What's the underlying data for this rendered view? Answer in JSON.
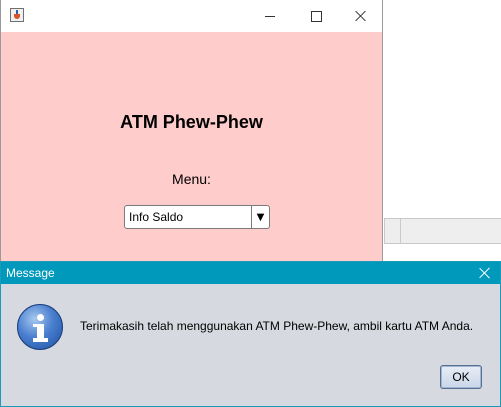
{
  "main_window": {
    "app_title": "ATM Phew-Phew",
    "menu_label": "Menu:",
    "menu_selected": "Info Saldo",
    "icons": {
      "app": "java-cup-icon",
      "minimize": "minimize-icon",
      "maximize": "maximize-icon",
      "close": "close-icon"
    }
  },
  "dialog": {
    "title": "Message",
    "message": "Terimakasih telah menggunakan ATM Phew-Phew, ambil kartu ATM Anda.",
    "ok_label": "OK",
    "icons": {
      "info": "info-icon",
      "close": "close-icon"
    }
  },
  "colors": {
    "window_background": "#ffcccc",
    "dialog_titlebar": "#0099bc",
    "dialog_background": "#d6d9df"
  }
}
